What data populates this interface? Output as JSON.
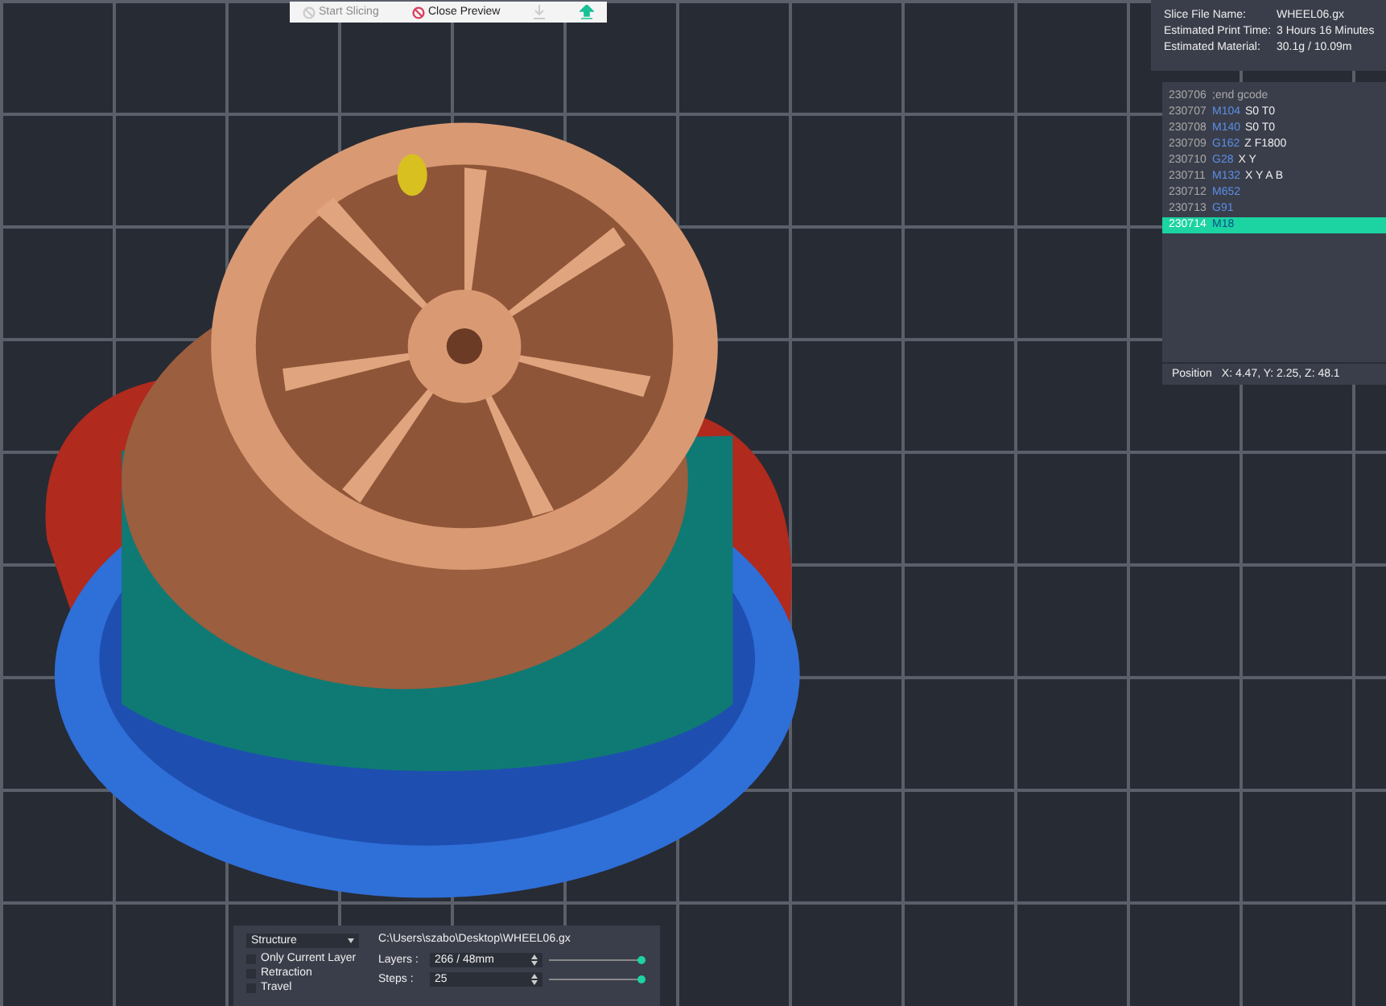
{
  "toolbar": {
    "buttons": [
      {
        "kind": "text",
        "label": "Start Slicing",
        "disabled": true
      },
      {
        "kind": "text",
        "label": "Close Preview",
        "disabled": false
      },
      {
        "kind": "download",
        "disabled": true
      },
      {
        "kind": "upload",
        "disabled": false
      }
    ]
  },
  "slice_info": {
    "rows": [
      {
        "label": "Slice File Name:",
        "value": "WHEEL06.gx"
      },
      {
        "label": "Estimated Print Time:",
        "value": "3 Hours 16 Minutes"
      },
      {
        "label": "Estimated Material:",
        "value": "30.1g / 10.09m"
      }
    ]
  },
  "gcode": {
    "lines": [
      {
        "number": "230706",
        "args": ";end gcode",
        "selected": false
      },
      {
        "number": "230707",
        "command": "M104",
        "args": "S0 T0",
        "selected": false
      },
      {
        "number": "230708",
        "command": "M140",
        "args": "S0 T0",
        "selected": false
      },
      {
        "number": "230709",
        "command": "G162",
        "args": "Z F1800",
        "selected": false
      },
      {
        "number": "230710",
        "command": "G28",
        "args": "X Y",
        "selected": false
      },
      {
        "number": "230711",
        "command": "M132",
        "args": "X Y A B",
        "selected": false
      },
      {
        "number": "230712",
        "command": "M652",
        "selected": false
      },
      {
        "number": "230713",
        "command": "G91",
        "selected": false
      },
      {
        "number": "230714",
        "command": "M18",
        "selected": true
      }
    ],
    "position_label": "Position",
    "position_value": "X: 4.47, Y: 2.25, Z: 48.1"
  },
  "preview_panel": {
    "view_mode": "Structure",
    "options": [
      {
        "label": "Only Current Layer",
        "checked": false
      },
      {
        "label": "Retraction",
        "checked": false
      },
      {
        "label": "Travel",
        "checked": false
      }
    ],
    "file_path": "C:\\Users\\szabo\\Desktop\\WHEEL06.gx",
    "layers": {
      "label": "Layers :",
      "value": "266 / 48mm",
      "level": 1
    },
    "steps": {
      "label": "Steps :",
      "value": "25",
      "level": 1
    }
  }
}
